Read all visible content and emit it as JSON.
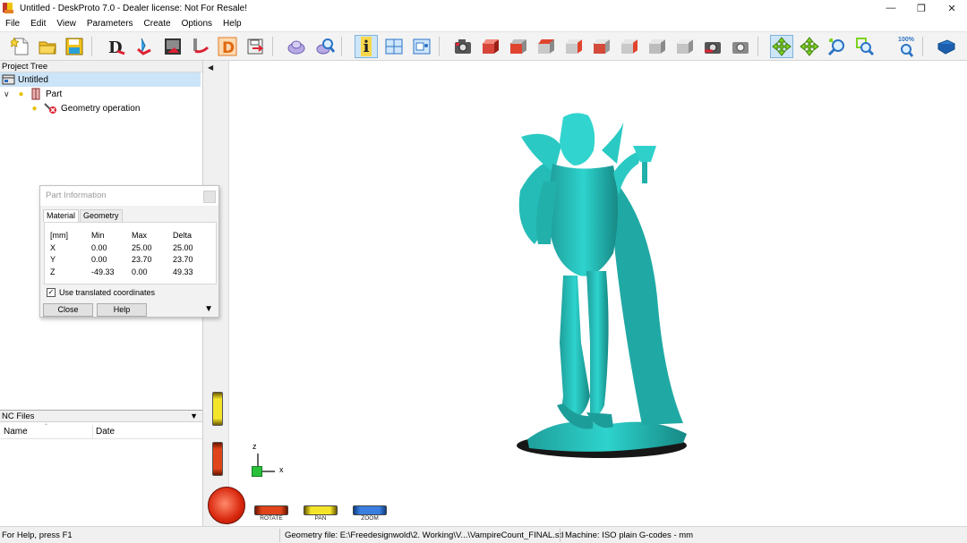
{
  "window": {
    "title": "Untitled - DeskProto 7.0 - Dealer license: Not For Resale!",
    "controls": [
      "—",
      "❐",
      "✕"
    ]
  },
  "menu": [
    "File",
    "Edit",
    "View",
    "Parameters",
    "Create",
    "Options",
    "Help"
  ],
  "toolbar": {
    "zoom_label": "100%",
    "icons": [
      "new-file-icon",
      "open-folder-icon",
      "save-icon",
      "draw-geometry-icon",
      "import-icon",
      "render-image-icon",
      "toolpath-icon",
      "dealer-icon",
      "export-icon",
      "part-import-icon",
      "part-search-icon",
      "info-icon",
      "layout-icon",
      "window-icon",
      "camera-icon",
      "view-iso-icon",
      "view-front-icon",
      "view-back-icon",
      "view-left-icon",
      "view-right-icon",
      "view-top-icon",
      "view-bottom-icon",
      "view-cube-icon",
      "view-plain-icon",
      "camera-prev-icon",
      "camera-next-icon",
      "rotate-mode-icon",
      "pan-mode-icon",
      "zoom-mode-icon",
      "zoom-window-icon",
      "zoom-100-icon",
      "help-book-icon"
    ],
    "accent": "#2f7fd1"
  },
  "project_tree": {
    "header": "Project Tree",
    "items": [
      {
        "label": "Untitled",
        "level": 0,
        "selected": true
      },
      {
        "label": "Part",
        "level": 1,
        "selected": false
      },
      {
        "label": "Geometry operation",
        "level": 2,
        "selected": false
      }
    ]
  },
  "nc_files": {
    "header": "NC Files",
    "columns": [
      "Name",
      "Date"
    ]
  },
  "part_info_dialog": {
    "title": "Part Information",
    "tabs": [
      "Material",
      "Geometry"
    ],
    "active_tab": "Material",
    "headers": [
      "[mm]",
      "Min",
      "Max",
      "Delta"
    ],
    "rows": [
      [
        "X",
        "0.00",
        "25.00",
        "25.00"
      ],
      [
        "Y",
        "0.00",
        "23.70",
        "23.70"
      ],
      [
        "Z",
        "-49.33",
        "0.00",
        "49.33"
      ]
    ],
    "checkbox_label": "Use translated coordinates",
    "checkbox_checked": true,
    "close_label": "Close",
    "help_label": "Help"
  },
  "viewport": {
    "model_color": "#2ec9c4",
    "axes": {
      "z": "z",
      "x": "x"
    },
    "controls": [
      {
        "label": "ROTATE",
        "color": "#e0441a"
      },
      {
        "label": "PAN",
        "color": "#e8d520"
      },
      {
        "label": "ZOOM",
        "color": "#3a7fe0"
      }
    ]
  },
  "status": {
    "help": "For Help, press F1",
    "geometry_file": "Geometry file: E:\\Freedesignwold\\2. Working\\V...\\VampireCount_FINAL.stl",
    "machine": "Machine: ISO plain G-codes - mm"
  }
}
